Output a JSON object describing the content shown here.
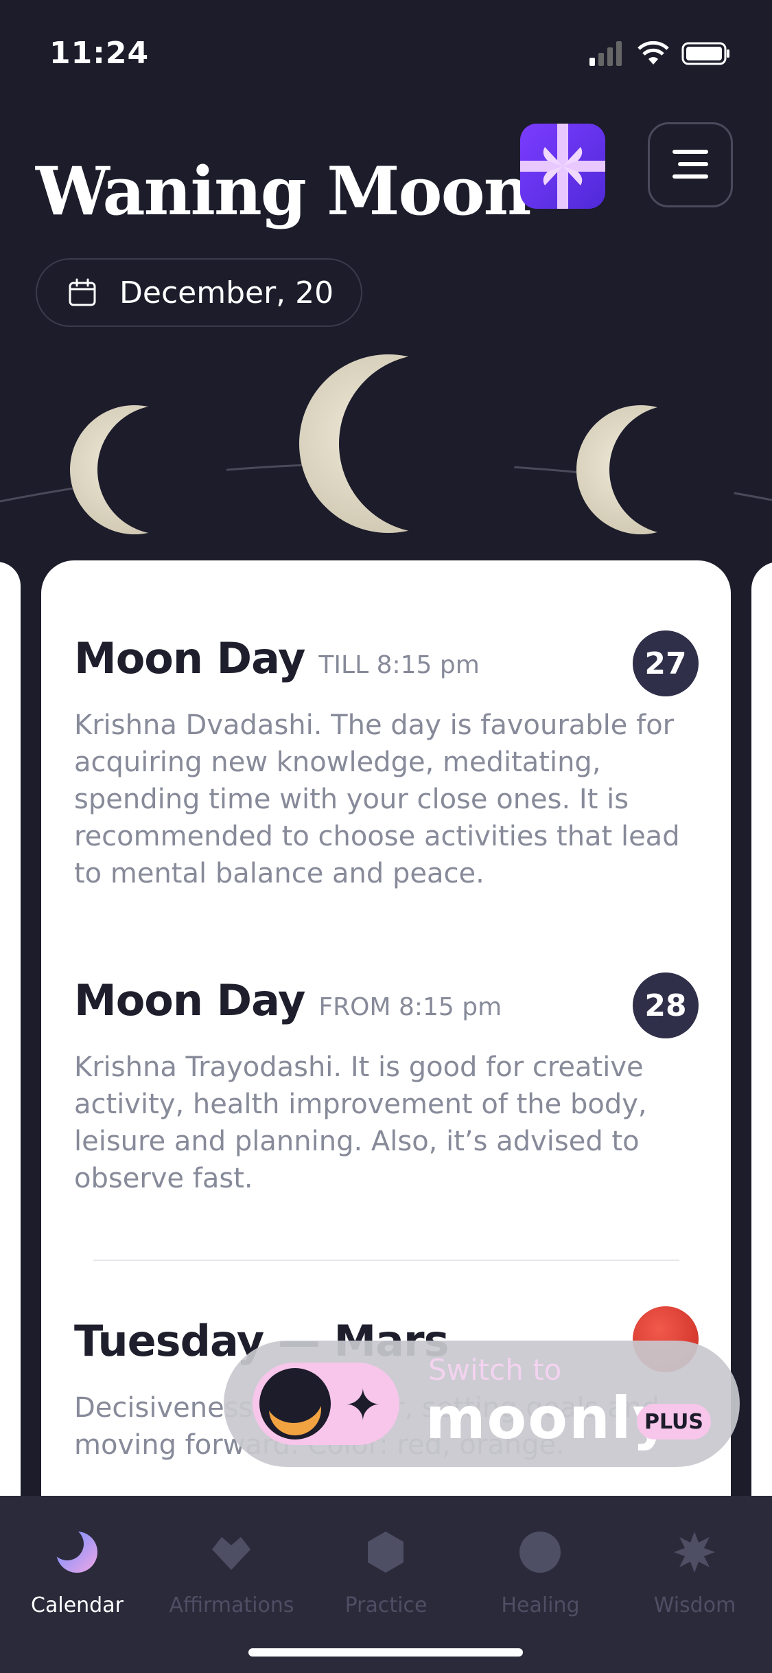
{
  "status": {
    "time": "11:24"
  },
  "header": {
    "title": "Waning Moon",
    "date": "December, 20"
  },
  "moon_days": [
    {
      "title": "Moon Day",
      "qualifier": "TILL 8:15 pm",
      "number": "27",
      "text": "Krishna Dvadashi. The day is favourable for acquiring new knowledge, meditating, spending time with your close ones. It is recommended to choose activities that lead to mental balance and peace."
    },
    {
      "title": "Moon Day",
      "qualifier": "FROM 8:15 pm",
      "number": "28",
      "text": "Krishna Trayodashi. It is good for creative activity, health improvement of the body, leisure and planning. Also, it’s advised to observe fast."
    }
  ],
  "weekday": {
    "title": "Tuesday — Mars",
    "text": "Decisiveness. Willpower, setting goals and moving forward. Color: red, orange."
  },
  "promo": {
    "switch_text": "Switch to",
    "brand": "moonly",
    "badge": "PLUS"
  },
  "tabs": [
    {
      "label": "Calendar",
      "icon": "moon-icon",
      "active": true
    },
    {
      "label": "Affirmations",
      "icon": "heart-icon",
      "active": false
    },
    {
      "label": "Practice",
      "icon": "hexagon-icon",
      "active": false
    },
    {
      "label": "Healing",
      "icon": "circle-icon",
      "active": false
    },
    {
      "label": "Wisdom",
      "icon": "star-icon",
      "active": false
    }
  ],
  "colors": {
    "background": "#1c1c2b",
    "card": "#ffffff",
    "accent": "#f7c6ea",
    "badge": "#2f2f4a",
    "mars": "#e0382e"
  }
}
